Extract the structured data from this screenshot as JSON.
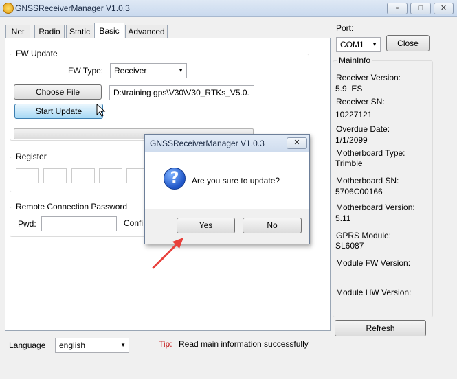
{
  "window": {
    "title": "GNSSReceiverManager V1.0.3"
  },
  "tabs": [
    {
      "label": "Net"
    },
    {
      "label": "Radio"
    },
    {
      "label": "Static"
    },
    {
      "label": "Basic",
      "active": true
    },
    {
      "label": "Advanced"
    }
  ],
  "fw_update": {
    "group_label": "FW Update",
    "fw_type_label": "FW Type:",
    "fw_type_value": "Receiver",
    "choose_file_label": "Choose File",
    "file_path": "D:\\training gps\\V30\\V30_RTKs_V5.0.",
    "start_update_label": "Start Update",
    "progress": 0
  },
  "register": {
    "group_label": "Register"
  },
  "remote": {
    "group_label": "Remote Connection Password",
    "pwd_label": "Pwd:",
    "confirm_label": "Confi"
  },
  "port": {
    "label": "Port:",
    "value": "COM1",
    "close_label": "Close"
  },
  "main_info": {
    "group_label": "MainInfo",
    "items": [
      {
        "label": "Receiver Version:",
        "value": "5.9  ES"
      },
      {
        "label": "Receiver SN:",
        "value": "10227121"
      },
      {
        "label": "Overdue Date:",
        "value": "1/1/2099"
      },
      {
        "label": "Motherboard Type:",
        "value": "Trimble"
      },
      {
        "label": "Motherboard SN:",
        "value": "5706C00166"
      },
      {
        "label": "Motherboard Version:",
        "value": "5.11"
      },
      {
        "label": "GPRS Module:",
        "value": "SL6087"
      },
      {
        "label": "Module FW Version:",
        "value": ""
      },
      {
        "label": "Module HW Version:",
        "value": ""
      }
    ],
    "refresh_label": "Refresh"
  },
  "footer": {
    "language_label": "Language",
    "language_value": "english",
    "tip_label": "Tip:",
    "tip_text": "Read main information successfully"
  },
  "dialog": {
    "title": "GNSSReceiverManager V1.0.3",
    "message": "Are you sure to update?",
    "yes_label": "Yes",
    "no_label": "No"
  },
  "colors": {
    "tip": "#c00000",
    "arrow": "#e8403b",
    "accent": "#3a8ee6"
  }
}
